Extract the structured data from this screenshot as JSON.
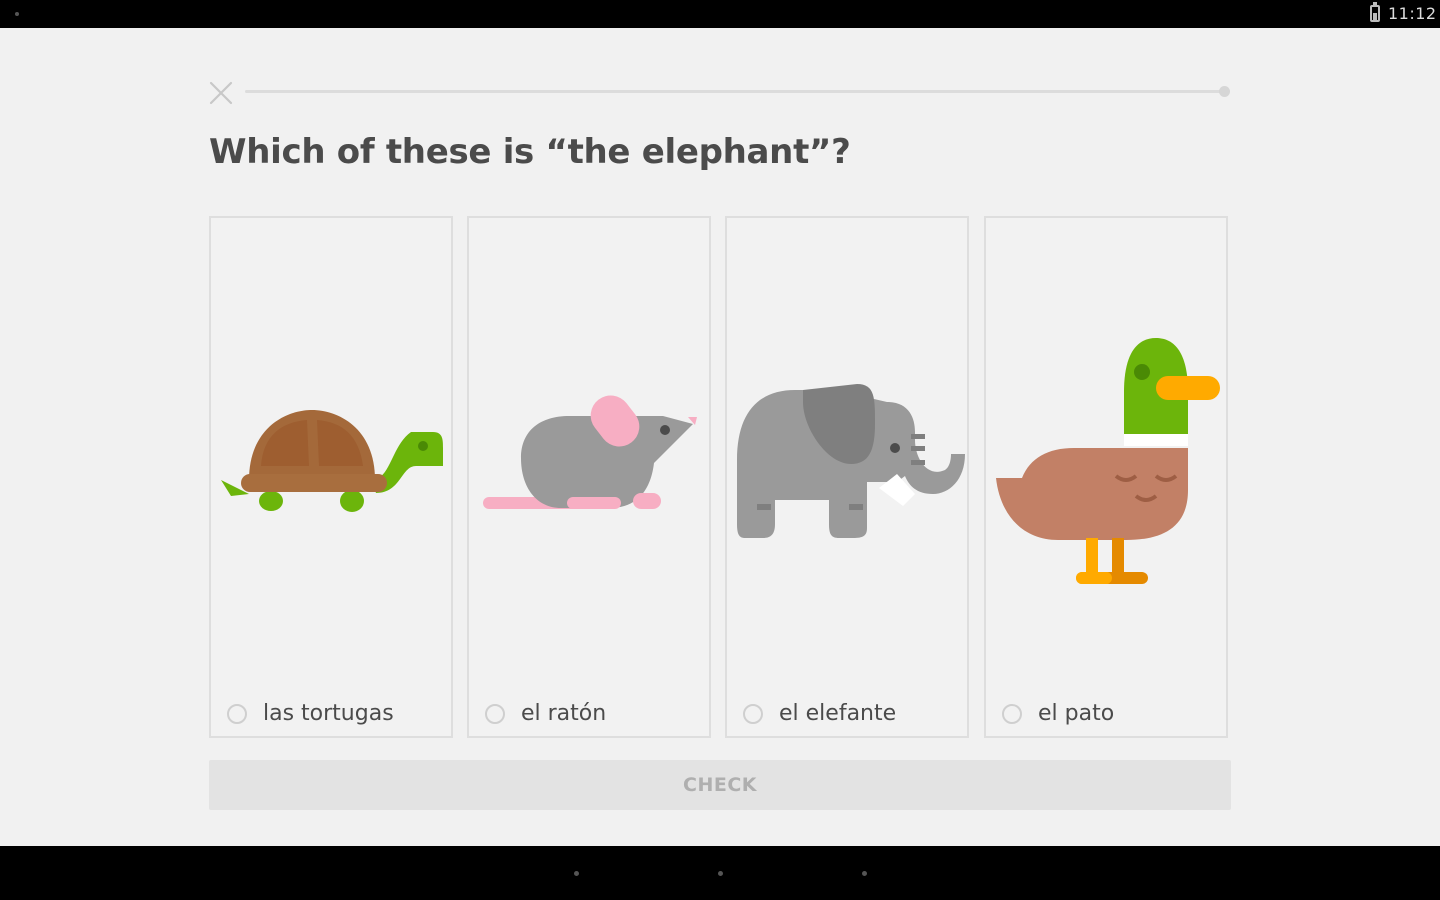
{
  "status_bar": {
    "time": "11:12",
    "battery_icon": "battery-icon"
  },
  "lesson": {
    "close_icon": "close-icon",
    "progress_fraction": 0.0,
    "question": "Which of these is “the elephant”?"
  },
  "choices": [
    {
      "label": "las tortugas",
      "image": "turtle"
    },
    {
      "label": "el ratón",
      "image": "mouse"
    },
    {
      "label": "el elefante",
      "image": "elephant"
    },
    {
      "label": "el pato",
      "image": "duck"
    }
  ],
  "check_button": {
    "label": "CHECK",
    "enabled": false
  },
  "colors": {
    "background": "#f1f1f1",
    "card_border": "#dedede",
    "text": "#4b4b4b",
    "button_disabled_bg": "#e3e3e3",
    "button_disabled_text": "#afafaf"
  },
  "nav_bar": {
    "buttons": [
      "back-icon",
      "home-icon",
      "recents-icon"
    ]
  }
}
